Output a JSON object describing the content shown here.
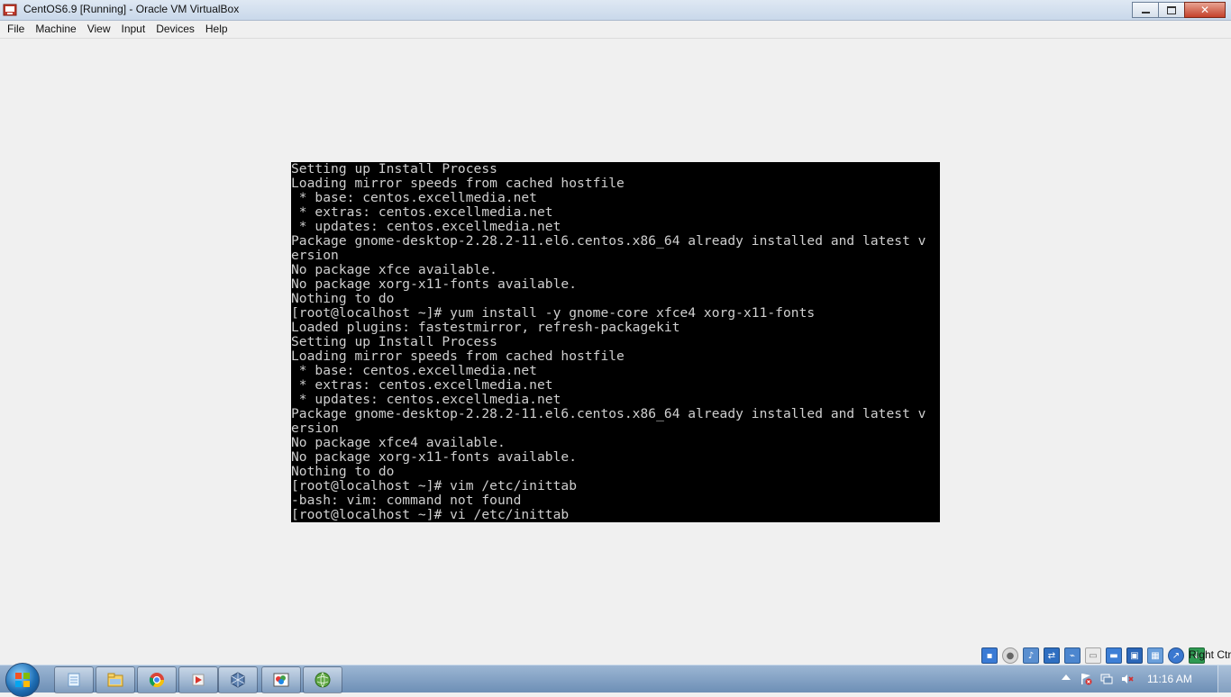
{
  "window": {
    "title": "CentOS6.9 [Running] - Oracle VM VirtualBox",
    "icon": "virtualbox-icon"
  },
  "menu": {
    "items": [
      {
        "label": "File"
      },
      {
        "label": "Machine"
      },
      {
        "label": "View"
      },
      {
        "label": "Input"
      },
      {
        "label": "Devices"
      },
      {
        "label": "Help"
      }
    ]
  },
  "console": {
    "lines": [
      "Setting up Install Process",
      "Loading mirror speeds from cached hostfile",
      " * base: centos.excellmedia.net",
      " * extras: centos.excellmedia.net",
      " * updates: centos.excellmedia.net",
      "Package gnome-desktop-2.28.2-11.el6.centos.x86_64 already installed and latest v",
      "ersion",
      "No package xfce available.",
      "No package xorg-x11-fonts available.",
      "Nothing to do",
      "[root@localhost ~]# yum install -y gnome-core xfce4 xorg-x11-fonts",
      "Loaded plugins: fastestmirror, refresh-packagekit",
      "Setting up Install Process",
      "Loading mirror speeds from cached hostfile",
      " * base: centos.excellmedia.net",
      " * extras: centos.excellmedia.net",
      " * updates: centos.excellmedia.net",
      "Package gnome-desktop-2.28.2-11.el6.centos.x86_64 already installed and latest v",
      "ersion",
      "No package xfce4 available.",
      "No package xorg-x11-fonts available.",
      "Nothing to do",
      "[root@localhost ~]# vim /etc/inittab",
      "-bash: vim: command not found",
      "[root@localhost ~]# vi /etc/inittab"
    ]
  },
  "statusbar": {
    "icons": [
      "hard-disk-icon",
      "optical-drive-icon",
      "audio-icon",
      "network-icon",
      "usb-icon",
      "shared-folders-icon",
      "display-icon",
      "video-capture-icon",
      "cpu-icon",
      "mouse-integration-icon",
      "keyboard-capture-icon"
    ],
    "host_key": "Right Ctrl"
  },
  "taskbar": {
    "apps": [
      "notepad-icon",
      "file-explorer-icon",
      "chrome-icon",
      "media-icon",
      "virtualbox-icon",
      "paint-icon",
      "browser-icon"
    ],
    "time": "11:16 AM"
  },
  "colors": {
    "console_bg": "#000000",
    "console_fg": "#cfcfcf"
  }
}
